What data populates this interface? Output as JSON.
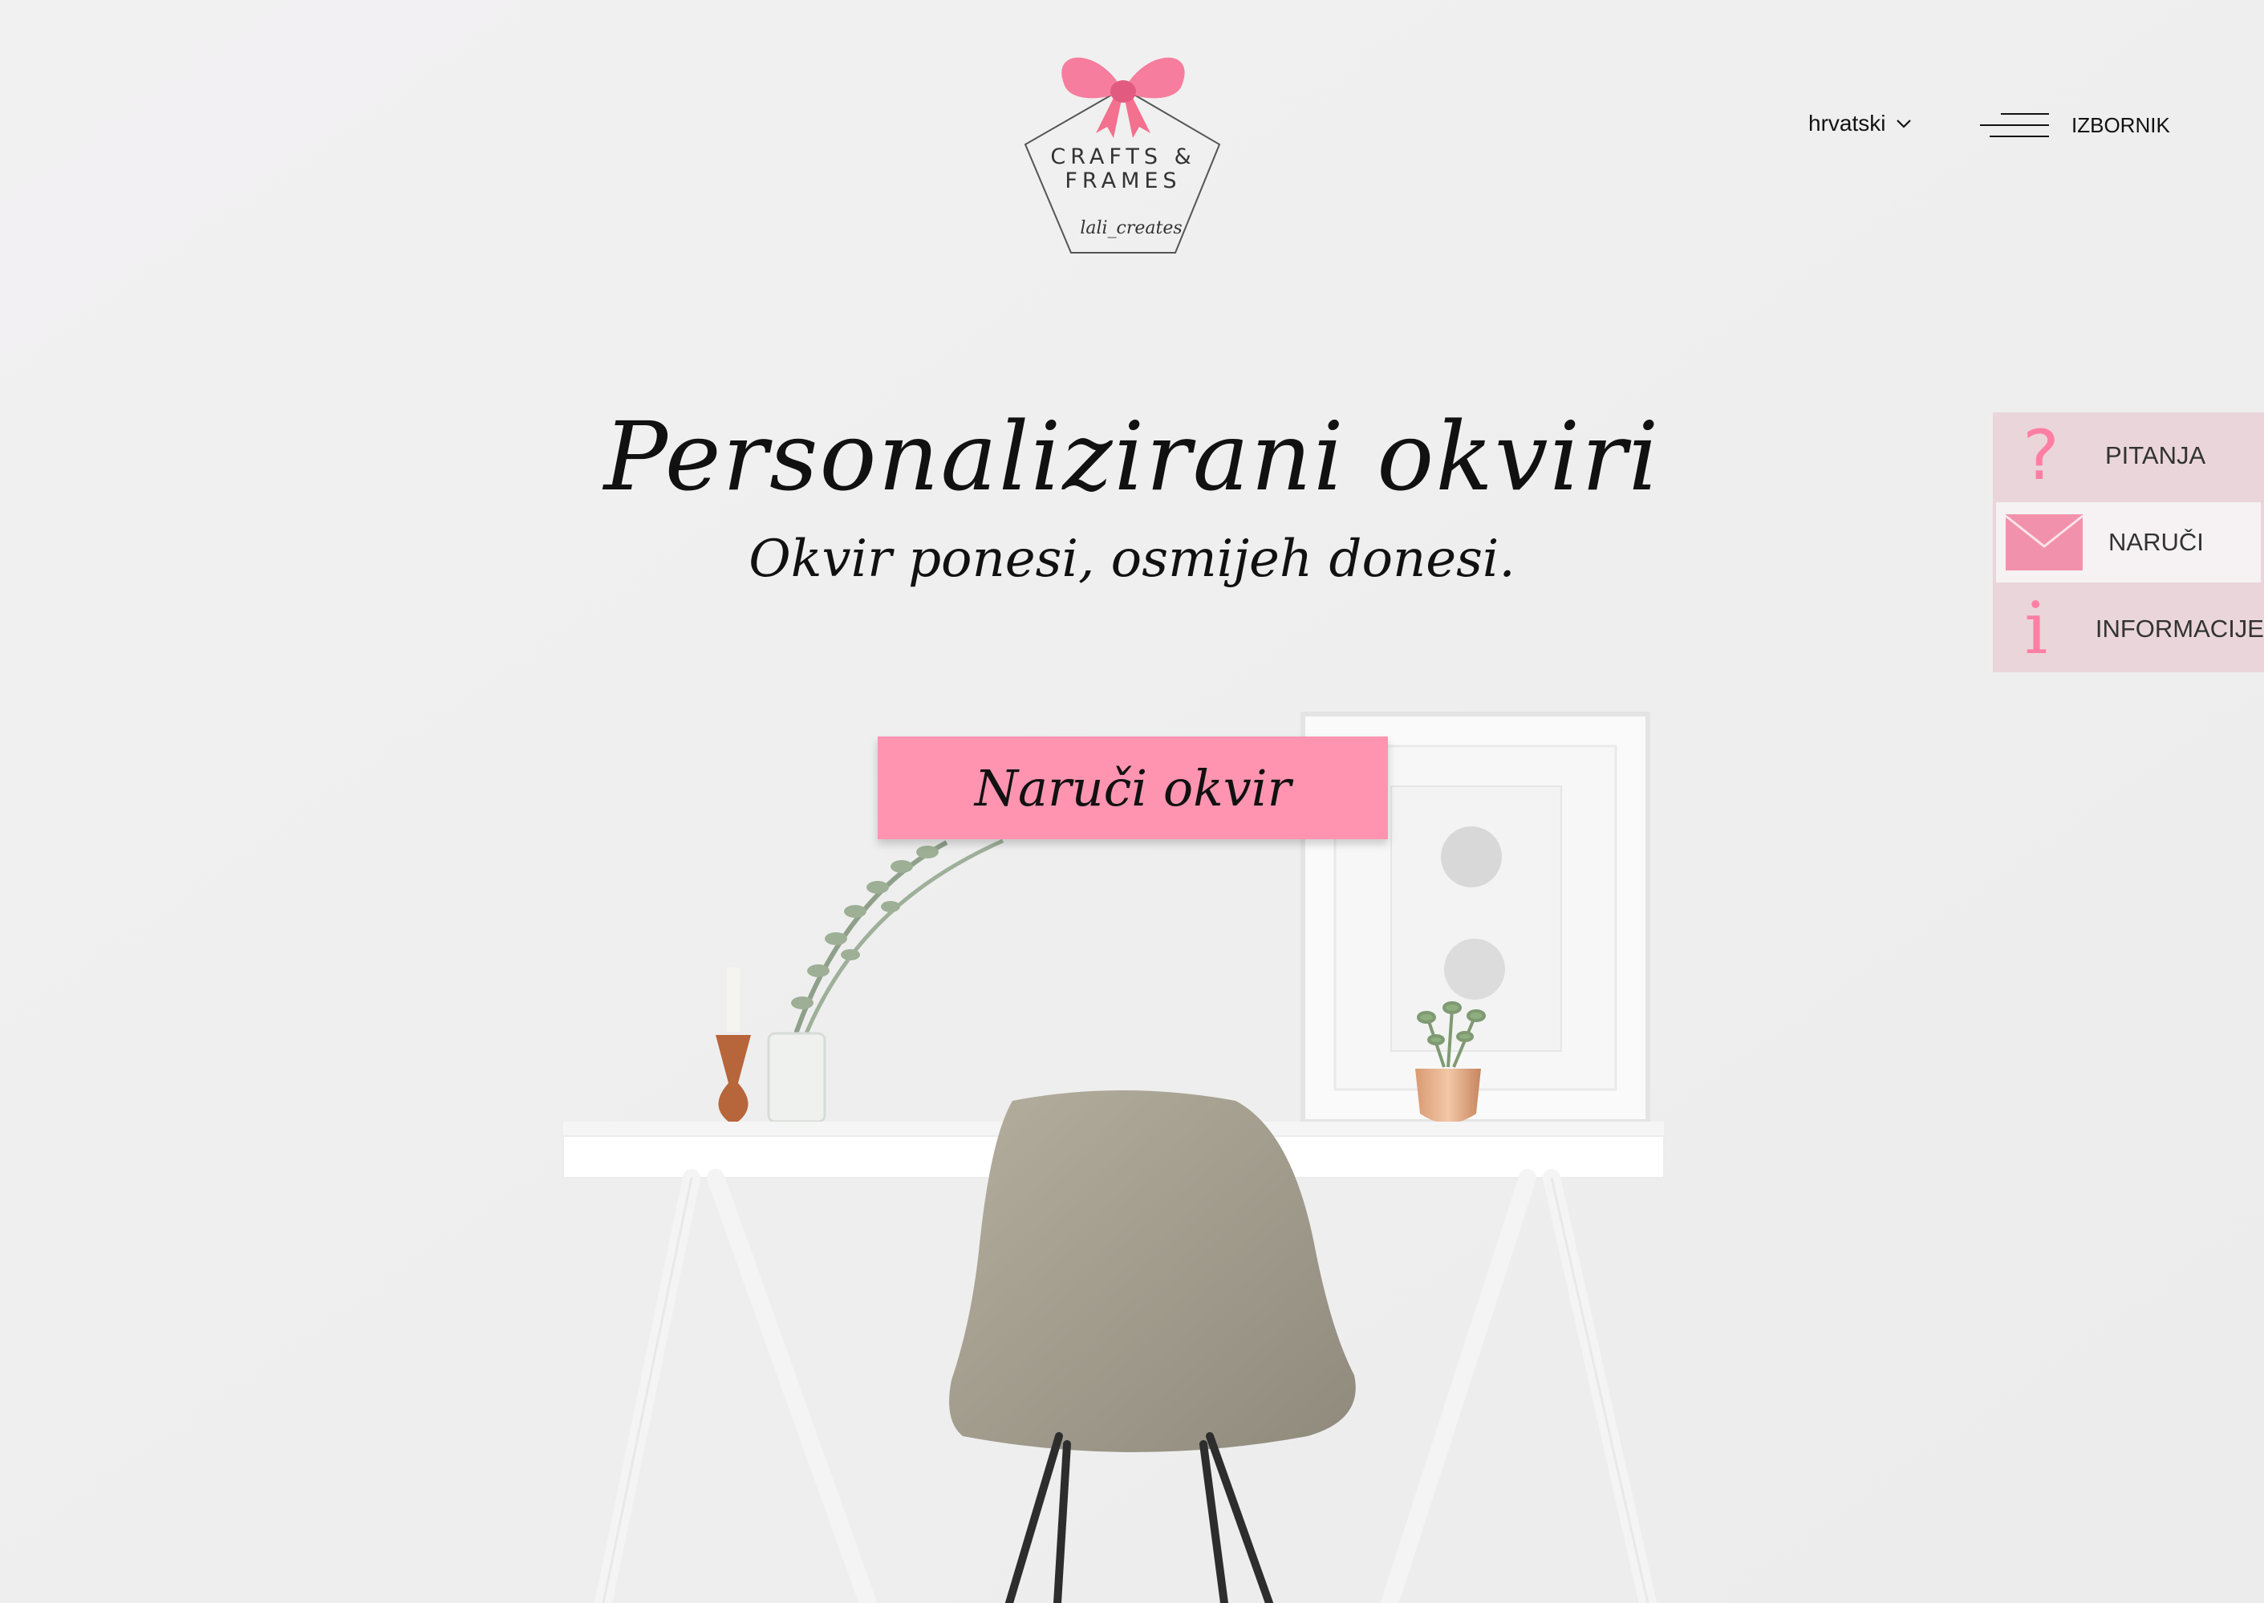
{
  "brand": {
    "line1": "CRAFTS &",
    "line2": "FRAMES",
    "signature": "lali_creates",
    "accent_color": "#ff94b1"
  },
  "header": {
    "language": "hrvatski",
    "menu_label": "IZBORNIK",
    "menu_icon": "hamburger-icon"
  },
  "hero": {
    "title": "Personalizirani okviri",
    "subtitle": "Okvir ponesi, osmijeh donesi.",
    "cta": "Naruči okvir"
  },
  "side_panel": {
    "items": [
      {
        "label": "PITANJA",
        "icon": "question-icon"
      },
      {
        "label": "NARUČI",
        "icon": "envelope-icon"
      },
      {
        "label": "INFORMACIJE",
        "icon": "info-icon"
      }
    ]
  }
}
